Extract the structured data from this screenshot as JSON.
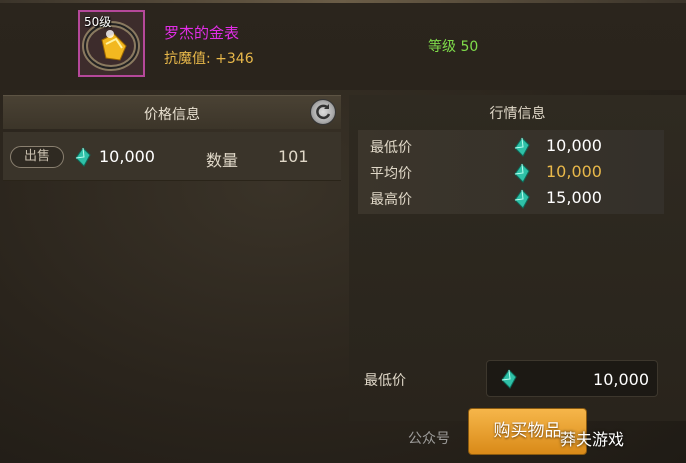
{
  "item": {
    "level_badge": "50级",
    "name": "罗杰的金表",
    "stat": "抗魔值: +346",
    "grade": "等级 50"
  },
  "price_panel": {
    "title": "价格信息",
    "row": {
      "type_badge": "出售",
      "price": "10,000",
      "qty_label": "数量",
      "qty": "101"
    }
  },
  "market_panel": {
    "title": "行情信息",
    "rows": [
      {
        "label": "最低价",
        "value": "10,000"
      },
      {
        "label": "平均价",
        "value": "10,000"
      },
      {
        "label": "最高价",
        "value": "15,000"
      }
    ]
  },
  "purchase": {
    "label": "最低价",
    "price": "10,000",
    "buy_label": "购买物品"
  },
  "watermark": {
    "left": "公众号",
    "right": "莽夫游戏"
  },
  "colors": {
    "item_name": "#e12de6",
    "stat": "#e8b84a",
    "grade": "#7fdc4a",
    "avg_price": "#e8b84a",
    "buy_button": "#f0a030"
  },
  "icons": [
    "refresh-icon",
    "gem-icon",
    "watch-item-icon"
  ]
}
